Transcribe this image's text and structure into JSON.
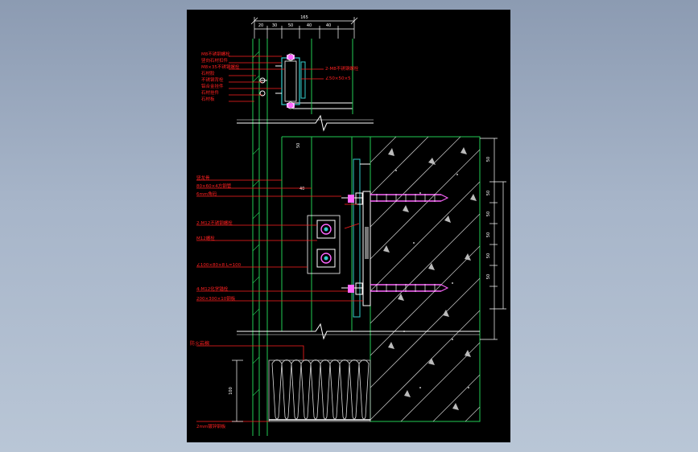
{
  "drawing": {
    "background": "#000000",
    "colors": {
      "structure": "#22cc55",
      "leader": "#ff2020",
      "steel": "#33cccc",
      "white": "#ffffff",
      "bolt": "#ff66ff",
      "insulation": "#cccccc"
    },
    "top_dims": {
      "overall": "165",
      "segments": [
        "20",
        "30",
        "50",
        "40",
        "40"
      ]
    },
    "labels_top": [
      "M8不锈钢螺栓",
      "竖向石材扣件",
      "M8×35不锈钢螺栓",
      "石材胶",
      "不锈钢背栓",
      "铝合金挂件",
      "石材挂件",
      "石材板"
    ],
    "labels_top_right": [
      "2-M8不锈钢螺栓",
      "∠50×50×5"
    ],
    "labels_mid": [
      "竖龙骨",
      "80×60×4方钢管",
      "6mm角码",
      "2-M12不锈钢螺栓",
      "M12螺栓",
      "∠100×80×8 L=100",
      "4-M12化学锚栓",
      "200×300×10钢板"
    ],
    "mid_dims": [
      "50",
      "40"
    ],
    "right_dims": [
      "50",
      "50",
      "50",
      "50",
      "50",
      "50"
    ],
    "labels_bottom": [
      "防火岩棉",
      "2mm镀锌钢板"
    ],
    "bottom_dim": "100"
  }
}
